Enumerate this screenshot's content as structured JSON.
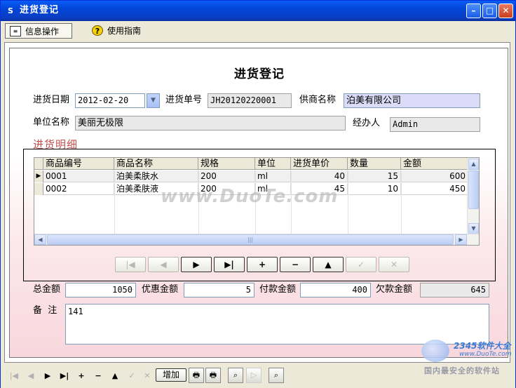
{
  "window": {
    "title": "进货登记",
    "icon": "app-icon"
  },
  "menubar": {
    "items": [
      {
        "label": "信息操作",
        "icon": "list-icon"
      },
      {
        "label": "使用指南",
        "icon": "help-icon"
      }
    ]
  },
  "form": {
    "title": "进货登记",
    "purchase_date_label": "进货日期",
    "purchase_date": "2012-02-20",
    "purchase_no_label": "进货单号",
    "purchase_no": "JH20120220001",
    "supplier_label": "供商名称",
    "supplier": "泊美有限公司",
    "unit_label": "单位名称",
    "unit": "美丽无极限",
    "handler_label": "经办人",
    "handler": "Admin"
  },
  "detail": {
    "title": "进货明细",
    "columns": [
      "商品编号",
      "商品名称",
      "规格",
      "单位",
      "进货单价",
      "数量",
      "金额"
    ],
    "rows": [
      [
        "0001",
        "泊美柔肤水",
        "200",
        "ml",
        "40",
        "15",
        "600"
      ],
      [
        "0002",
        "泊美柔肤液",
        "200",
        "ml",
        "45",
        "10",
        "450"
      ]
    ],
    "nav_buttons": [
      {
        "name": "nav-first-button",
        "label": "|◀",
        "enabled": false
      },
      {
        "name": "nav-prev-button",
        "label": "◀",
        "enabled": false
      },
      {
        "name": "nav-next-button",
        "label": "▶",
        "enabled": true
      },
      {
        "name": "nav-last-button",
        "label": "▶|",
        "enabled": true
      },
      {
        "name": "nav-add-button",
        "label": "+",
        "enabled": true
      },
      {
        "name": "nav-delete-button",
        "label": "−",
        "enabled": true
      },
      {
        "name": "nav-edit-button",
        "label": "▲",
        "enabled": true
      },
      {
        "name": "nav-post-button",
        "label": "✓",
        "enabled": false
      },
      {
        "name": "nav-cancel-button",
        "label": "✕",
        "enabled": false
      }
    ]
  },
  "totals": {
    "total_label": "总金额",
    "total": "1050",
    "discount_label": "优惠金额",
    "discount": "5",
    "paid_label": "付款金额",
    "paid": "400",
    "owed_label": "欠款金额",
    "owed": "645",
    "remark_label": "备  注",
    "remark": "141"
  },
  "watermark": "www.DuoTe.com",
  "bottombar": {
    "add_label": "增加",
    "items": [
      {
        "name": "bb-first-button",
        "label": "|◀",
        "enabled": false
      },
      {
        "name": "bb-prev-button",
        "label": "◀",
        "enabled": false
      },
      {
        "name": "bb-next-button",
        "label": "▶",
        "enabled": true
      },
      {
        "name": "bb-last-button",
        "label": "▶|",
        "enabled": true
      },
      {
        "name": "bb-add-button",
        "label": "+",
        "enabled": true
      },
      {
        "name": "bb-delete-button",
        "label": "−",
        "enabled": true
      },
      {
        "name": "bb-edit-button",
        "label": "▲",
        "enabled": true
      },
      {
        "name": "bb-post-button",
        "label": "✓",
        "enabled": false
      },
      {
        "name": "bb-cancel-button",
        "label": "✕",
        "enabled": false
      }
    ]
  },
  "logo": {
    "line1": "2345软件大全",
    "line2": "www.DuoTe.com",
    "line3": "国内最安全的软件站"
  },
  "colors": {
    "titlebar": "#0a5cf7",
    "highlight_field": "#dcdcf8",
    "detail_title": "#c0504d",
    "panel_gradient_end": "#f8d7dd"
  }
}
